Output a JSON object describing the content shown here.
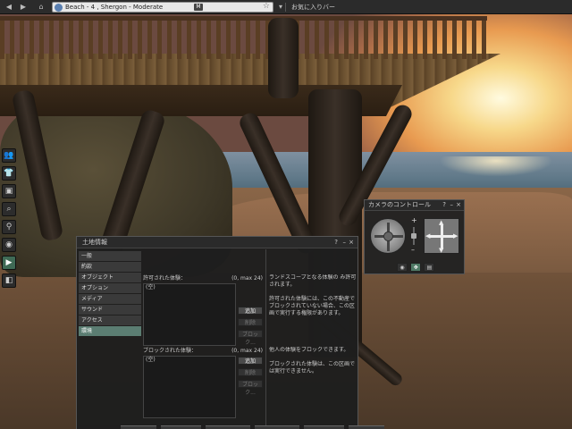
{
  "browser": {
    "url_text": "Beach - 4 , Shergon - Moderate",
    "rating_badge": "M",
    "favorites_label": "お気に入りバー"
  },
  "sidebar": {
    "items": [
      {
        "name": "people",
        "glyph": "👥"
      },
      {
        "name": "appearance",
        "glyph": "👕"
      },
      {
        "name": "inventory",
        "glyph": "▣"
      },
      {
        "name": "search",
        "glyph": "⌕"
      },
      {
        "name": "places",
        "glyph": "⚲"
      },
      {
        "name": "snapshot",
        "glyph": "◉"
      },
      {
        "name": "camera",
        "glyph": "▶",
        "active": true
      },
      {
        "name": "profile",
        "glyph": "◧"
      }
    ]
  },
  "land_window": {
    "title": "土地情報",
    "controls": {
      "help": "?",
      "minimize": "–",
      "close": "×"
    },
    "tabs": [
      {
        "label": "一般"
      },
      {
        "label": "約款"
      },
      {
        "label": "オブジェクト"
      },
      {
        "label": "オプション"
      },
      {
        "label": "メディア"
      },
      {
        "label": "サウンド"
      },
      {
        "label": "アクセス"
      },
      {
        "label": "環境",
        "active": true
      }
    ],
    "allowed": {
      "header": "許可された体験：",
      "count": "(0, max 24)",
      "list_item": "(空)",
      "add": "追加",
      "remove": "削除",
      "block": "ブロック..."
    },
    "allowed_desc": [
      "ランドスコープとなる体験の み許可されます。",
      "許可された体験には、この不動産でブロックされていない場合、この区画で実行する権限があります。"
    ],
    "blocked": {
      "header": "ブロックされた体験：",
      "count": "(0, max 24)",
      "list_item": "(空)",
      "add": "追加",
      "remove": "削除",
      "block": "ブロック..."
    },
    "blocked_desc": [
      "他人の体験をブロックできます。",
      "ブロックされた体験は、この区画では実行できません。"
    ]
  },
  "camera_window": {
    "title": "カメラのコントロール",
    "controls": {
      "help": "?",
      "minimize": "–",
      "close": "×"
    },
    "zoom_plus": "+",
    "zoom_minus": "–",
    "zoom_level": 0.5,
    "modes": [
      {
        "name": "eye",
        "glyph": "◉"
      },
      {
        "name": "object",
        "glyph": "✥",
        "active": true
      },
      {
        "name": "presets",
        "glyph": "▤"
      }
    ]
  }
}
